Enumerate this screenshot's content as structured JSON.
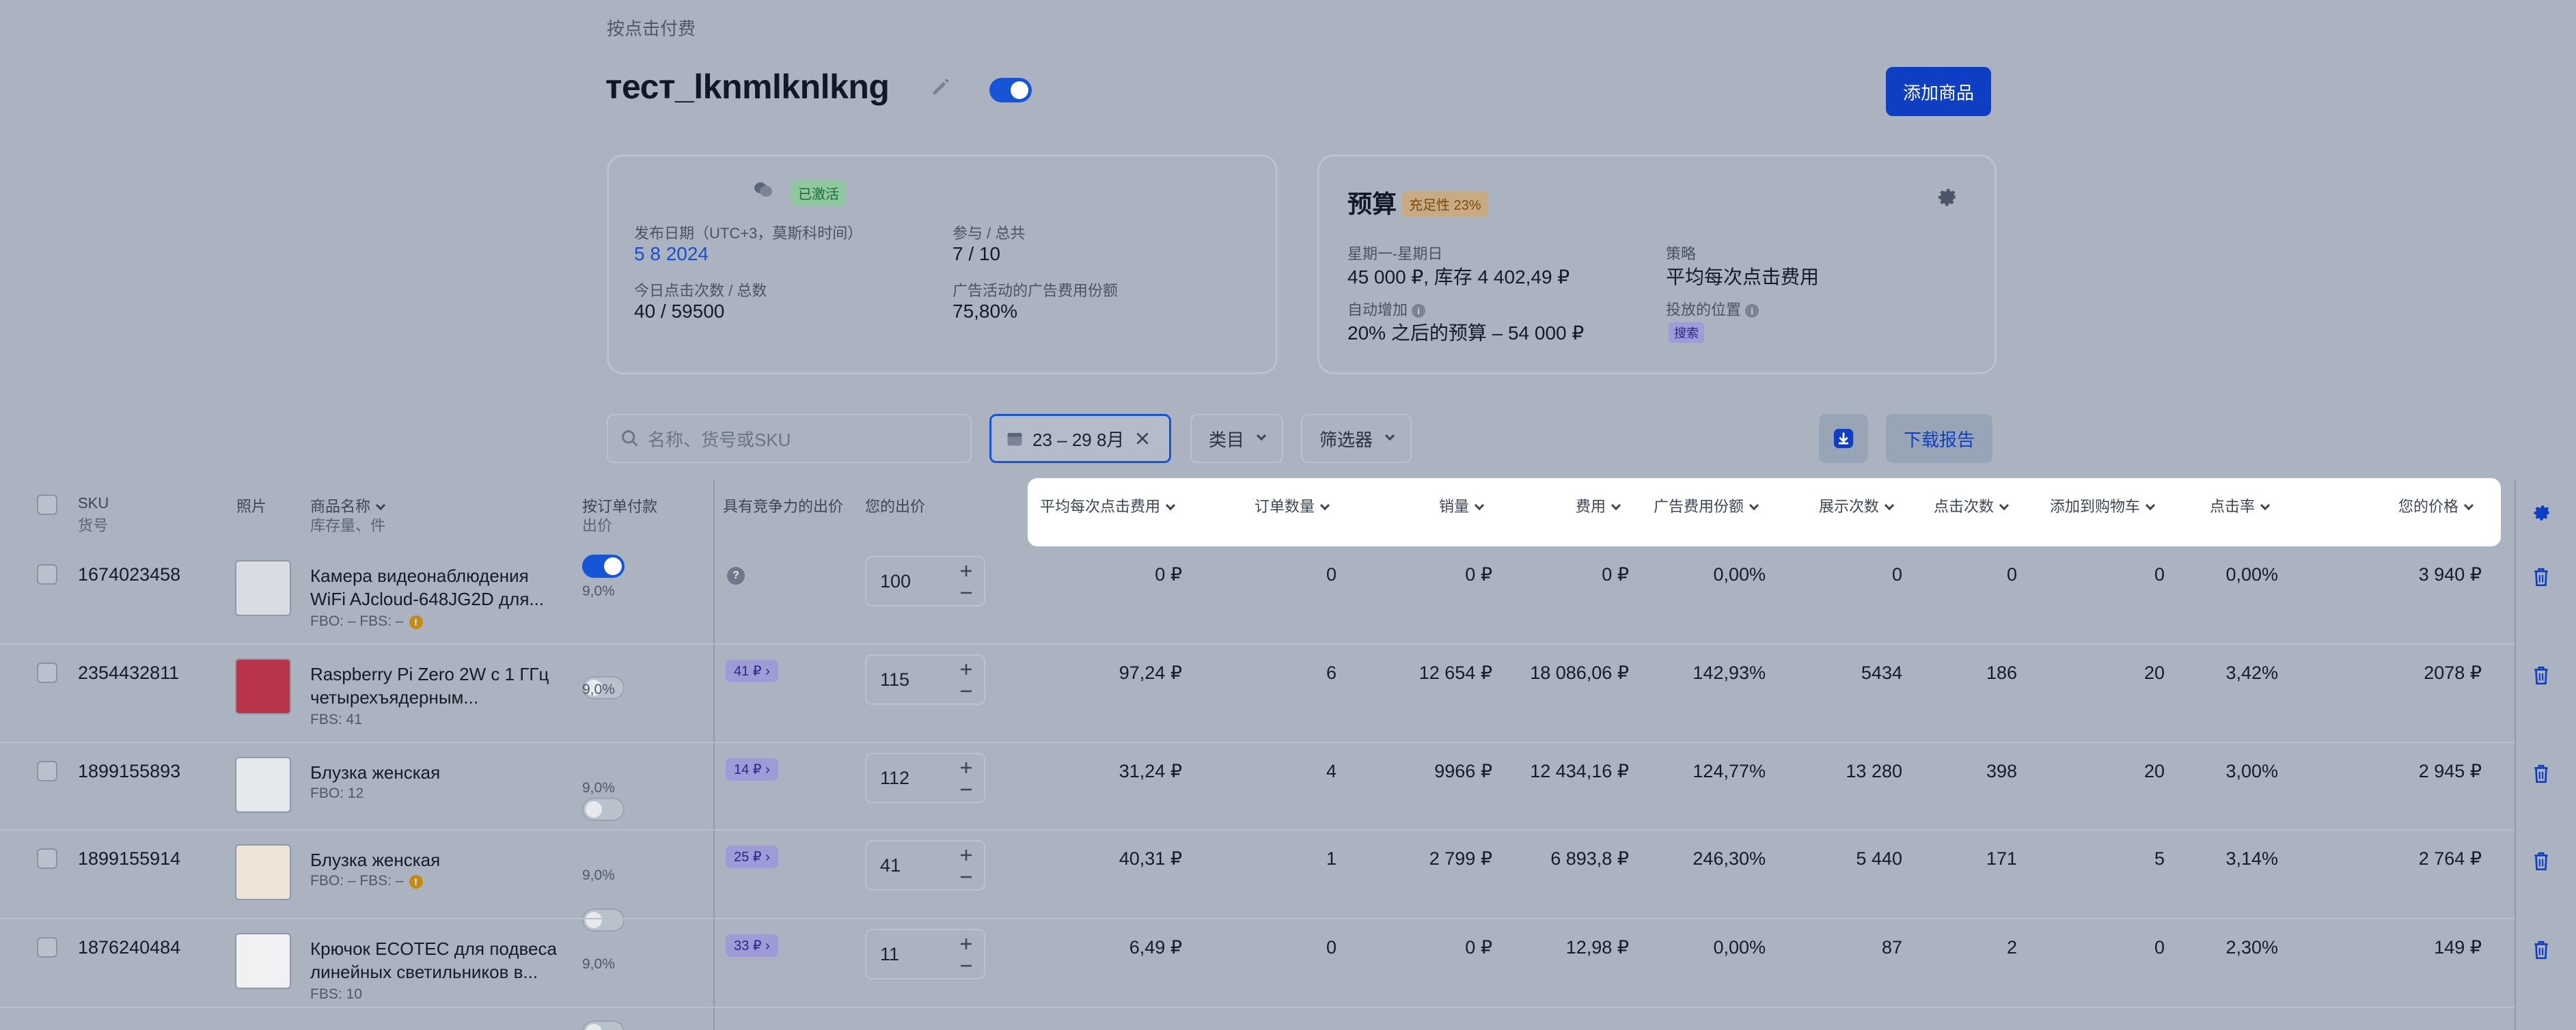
{
  "breadcrumb": "按点击付费",
  "campaign": {
    "title": "тест_lknmlknlkng",
    "add_product": "添加商品"
  },
  "left_card": {
    "status": "已激活",
    "publish_label": "发布日期（UTC+3，莫斯科时间）",
    "publish_value": "5 8 2024",
    "participation_label": "参与 / 总共",
    "participation_value": "7 / 10",
    "clicks_label": "今日点击次数 / 总数",
    "clicks_value": "40 / 59500",
    "ad_share_label": "广告活动的广告费用份额",
    "ad_share_value": "75,80%"
  },
  "right_card": {
    "title": "预算",
    "budget_badge": "充足性 23%",
    "week_label": "星期一-星期日",
    "week_value": "45 000 ₽, 库存 4 402,49 ₽",
    "auto_label": "自动增加",
    "auto_value": "20% 之后的预算 – 54 000 ₽",
    "strategy_label": "策略",
    "strategy_value": "平均每次点击费用",
    "placement_label": "投放的位置",
    "placement_value": "搜索"
  },
  "toolbar": {
    "search_placeholder": "名称、货号或SKU",
    "date_range": "23 – 29 8月",
    "category": "类目",
    "filter": "筛选器",
    "download_report": "下载报告"
  },
  "table": {
    "headers": {
      "sku": "SKU",
      "article": "货号",
      "photo": "照片",
      "name": "商品名称",
      "stock": "库存量、件",
      "pay_per_order": "按订单付款",
      "bid": "出价",
      "competitive_bid": "具有竞争力的出价",
      "your_bid": "您的出价",
      "avg_cpc": "平均每次点击费用",
      "orders": "订单数量",
      "sales": "销量",
      "cost": "费用",
      "ad_cost_share": "广告费用份额",
      "impressions": "展示次数",
      "clicks": "点击次数",
      "add_to_cart": "添加到购物车",
      "ctr": "点击率",
      "your_price": "您的价格"
    },
    "rows": [
      {
        "sku": "1674023458",
        "name1": "Камера видеонаблюдения",
        "name2": "WiFi AJcloud-648JG2D для...",
        "stock": "FBO: –    FBS: –",
        "warn": true,
        "toggle": "on",
        "pct": "9,0%",
        "comp": "",
        "bid": "100",
        "cpc": "0 ₽",
        "orders": "0",
        "sales": "0 ₽",
        "cost": "0 ₽",
        "share": "0,00%",
        "impr": "0",
        "clicks": "0",
        "cart": "0",
        "ctr": "0,00%",
        "price": "3 940 ₽"
      },
      {
        "sku": "2354432811",
        "name1": "Raspberry Pi Zero 2W с 1 ГГц",
        "name2": "четырехъядерным...",
        "stock": "FBS: 41",
        "warn": false,
        "toggle": "off",
        "pct": "9,0%",
        "comp": "41 ₽",
        "bid": "115",
        "cpc": "97,24 ₽",
        "orders": "6",
        "sales": "12 654 ₽",
        "cost": "18 086,06 ₽",
        "share": "142,93%",
        "impr": "5434",
        "clicks": "186",
        "cart": "20",
        "ctr": "3,42%",
        "price": "2078 ₽"
      },
      {
        "sku": "1899155893",
        "name1": "Блузка женская",
        "name2": "",
        "stock": "FBO: 12",
        "warn": false,
        "toggle": "off",
        "pct": "9,0%",
        "comp": "14 ₽",
        "bid": "112",
        "cpc": "31,24 ₽",
        "orders": "4",
        "sales": "9966 ₽",
        "cost": "12 434,16 ₽",
        "share": "124,77%",
        "impr": "13 280",
        "clicks": "398",
        "cart": "20",
        "ctr": "3,00%",
        "price": "2 945 ₽"
      },
      {
        "sku": "1899155914",
        "name1": "Блузка женская",
        "name2": "",
        "stock": "FBO: –    FBS: –",
        "warn": true,
        "toggle": "off",
        "pct": "9,0%",
        "comp": "25 ₽",
        "bid": "41",
        "cpc": "40,31 ₽",
        "orders": "1",
        "sales": "2 799 ₽",
        "cost": "6 893,8 ₽",
        "share": "246,30%",
        "impr": "5 440",
        "clicks": "171",
        "cart": "5",
        "ctr": "3,14%",
        "price": "2 764 ₽"
      },
      {
        "sku": "1876240484",
        "name1": "Крючок ECOTEC для подвеса",
        "name2": "линейных светильников в...",
        "stock": "FBS: 10",
        "warn": false,
        "toggle": "off",
        "pct": "9,0%",
        "comp": "33 ₽",
        "bid": "11",
        "cpc": "6,49 ₽",
        "orders": "0",
        "sales": "0 ₽",
        "cost": "12,98 ₽",
        "share": "0,00%",
        "impr": "87",
        "clicks": "2",
        "cart": "0",
        "ctr": "2,30%",
        "price": "149 ₽"
      }
    ]
  },
  "colors": {
    "accent": "#1656d6",
    "primary_button": "#0d3ec4",
    "background": "#aab3bf"
  },
  "icons": [
    "pencil-icon",
    "gear-icon",
    "search-icon",
    "calendar-icon",
    "close-icon",
    "download-icon",
    "trash-icon",
    "chevron-down-icon",
    "question-icon",
    "warning-icon"
  ]
}
